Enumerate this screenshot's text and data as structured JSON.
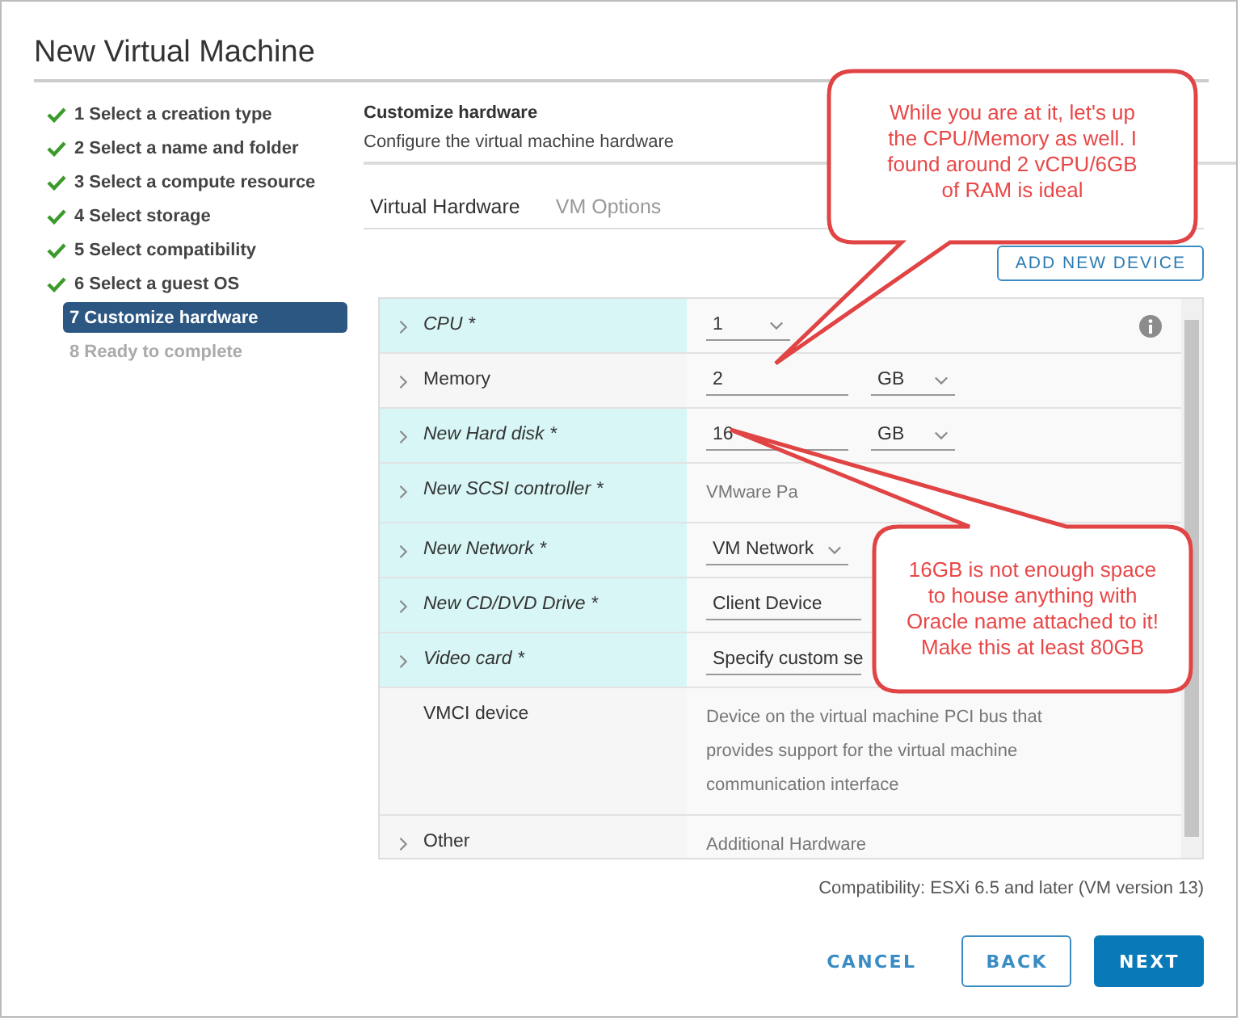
{
  "window": {
    "title": "New Virtual Machine"
  },
  "steps": [
    {
      "label": "1 Select a creation type",
      "done": true,
      "selected": false,
      "disabled": false
    },
    {
      "label": "2 Select a name and folder",
      "done": true,
      "selected": false,
      "disabled": false
    },
    {
      "label": "3 Select a compute resource",
      "done": true,
      "selected": false,
      "disabled": false
    },
    {
      "label": "4 Select storage",
      "done": true,
      "selected": false,
      "disabled": false
    },
    {
      "label": "5 Select compatibility",
      "done": true,
      "selected": false,
      "disabled": false
    },
    {
      "label": "6 Select a guest OS",
      "done": true,
      "selected": false,
      "disabled": false
    },
    {
      "label": "7 Customize hardware",
      "done": false,
      "selected": true,
      "disabled": false
    },
    {
      "label": "8 Ready to complete",
      "done": false,
      "selected": false,
      "disabled": true
    }
  ],
  "header": {
    "title": "Customize hardware",
    "subtitle": "Configure the virtual machine hardware"
  },
  "tabs": [
    {
      "label": "Virtual Hardware",
      "selected": true
    },
    {
      "label": "VM Options",
      "selected": false
    }
  ],
  "add_button": "ADD NEW DEVICE",
  "hardware": [
    {
      "label": "CPU *",
      "modified": true,
      "expandable": true,
      "kind": "select",
      "value": "1",
      "info": true
    },
    {
      "label": "Memory",
      "modified": false,
      "expandable": true,
      "kind": "input_unit",
      "value": "2",
      "unit": "GB",
      "info": false
    },
    {
      "label": "New Hard disk *",
      "modified": true,
      "expandable": true,
      "kind": "input_unit",
      "value": "16",
      "unit": "GB",
      "info": false
    },
    {
      "label": "New SCSI controller *",
      "modified": true,
      "expandable": true,
      "kind": "text",
      "value": "VMware Pa",
      "info": false
    },
    {
      "label": "New Network *",
      "modified": true,
      "expandable": true,
      "kind": "select",
      "value": "VM Network",
      "info": false
    },
    {
      "label": "New CD/DVD Drive *",
      "modified": true,
      "expandable": true,
      "kind": "select_plain",
      "value": "Client Device",
      "info": false
    },
    {
      "label": "Video card *",
      "modified": true,
      "expandable": true,
      "kind": "select_plain",
      "value": "Specify custom se",
      "info": false
    },
    {
      "label": "VMCI device",
      "modified": false,
      "expandable": false,
      "kind": "text",
      "value": "Device on the virtual machine PCI bus that provides support for the virtual machine communication interface",
      "info": false
    },
    {
      "label": "Other",
      "modified": false,
      "expandable": true,
      "kind": "text",
      "value": "Additional Hardware",
      "info": false
    }
  ],
  "compatibility": "Compatibility: ESXi 6.5 and later (VM version 13)",
  "buttons": [
    {
      "label": "CANCEL",
      "kind": "link"
    },
    {
      "label": "BACK",
      "kind": "outline"
    },
    {
      "label": "NEXT",
      "kind": "primary"
    }
  ],
  "callouts": [
    {
      "text": "While you are at it, let's up the CPU/Memory as well. I found around 2 vCPU/6GB of RAM is ideal"
    },
    {
      "text": "16GB is not enough space to house anything with Oracle name attached to it! Make this at least 80GB"
    }
  ]
}
